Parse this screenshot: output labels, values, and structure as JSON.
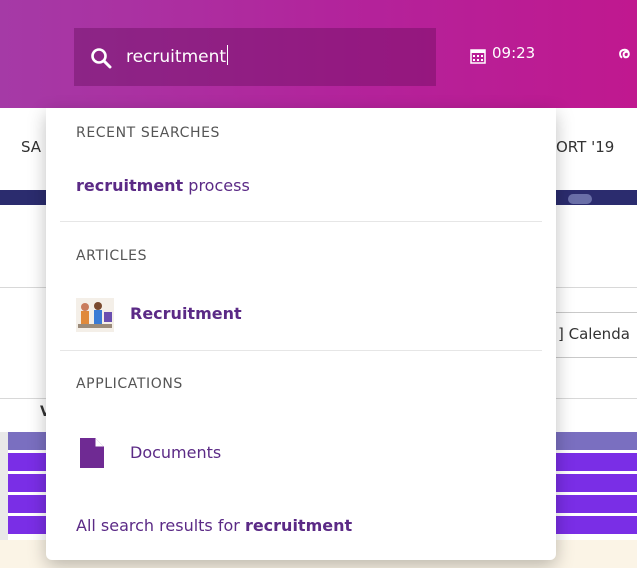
{
  "header": {
    "search": {
      "value": "recruitment",
      "icon": "search-icon"
    },
    "clock": {
      "time": "09:23",
      "icon": "calendar-icon"
    },
    "symbol": "ര"
  },
  "background": {
    "nav_left": "SA",
    "nav_right": "ORT '19",
    "calendar_button": "] Calenda",
    "column_char": "V"
  },
  "dropdown": {
    "recent": {
      "heading": "RECENT SEARCHES",
      "items": [
        {
          "bold": "recruitment",
          "rest": " process"
        }
      ]
    },
    "articles": {
      "heading": "ARTICLES",
      "items": [
        {
          "label": "Recruitment",
          "icon": "article-thumbnail"
        }
      ]
    },
    "applications": {
      "heading": "APPLICATIONS",
      "items": [
        {
          "label": "Documents",
          "icon": "document-icon"
        }
      ]
    },
    "all_results": {
      "prefix": "All search results for ",
      "term": "recruitment"
    }
  },
  "colors": {
    "header_start": "#a53aa6",
    "header_end": "#c0188f",
    "accent_text": "#5b2a86",
    "navy": "#2b2c6e",
    "bar_purple": "#7a2ee6"
  }
}
